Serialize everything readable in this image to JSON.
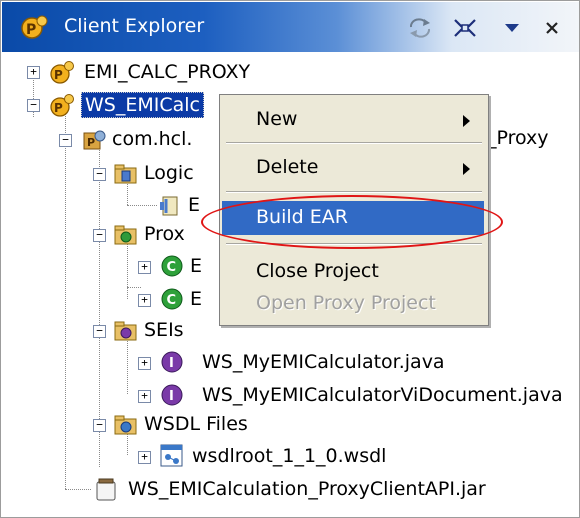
{
  "titlebar": {
    "title": "Client Explorer",
    "buttons": [
      "sync-icon",
      "collapse-all-icon",
      "view-menu-icon",
      "close-icon"
    ]
  },
  "tree": {
    "items": [
      {
        "label": "EMI_CALC_PROXY",
        "icon": "proxy-project-icon"
      },
      {
        "label": "WS_EMICalc",
        "icon": "proxy-project-icon"
      },
      {
        "label": "com.hcl.",
        "icon": "package-icon"
      },
      {
        "label": "Logic",
        "icon": "logical-folder-icon"
      },
      {
        "label": "E",
        "icon": "logical-item-icon"
      },
      {
        "label": "Prox",
        "icon": "proxy-folder-icon"
      },
      {
        "label": "E",
        "icon": "class-icon"
      },
      {
        "label": "E",
        "icon": "class-icon"
      },
      {
        "label": "SEIs",
        "icon": "sei-folder-icon"
      },
      {
        "label": "WS_MyEMICalculator.java",
        "icon": "interface-icon"
      },
      {
        "label": "WS_MyEMICalculatorViDocument.java",
        "icon": "interface-icon"
      },
      {
        "label": "WSDL Files",
        "icon": "wsdl-folder-icon"
      },
      {
        "label": "wsdlroot_1_1_0.wsdl",
        "icon": "wsdl-file-icon"
      },
      {
        "label": "WS_EMICalculation_ProxyClientAPI.jar",
        "icon": "jar-icon"
      }
    ],
    "partial_text": "_Proxy"
  },
  "context_menu": {
    "items": [
      {
        "label": "New",
        "submenu": true,
        "enabled": true
      },
      {
        "label": "Delete",
        "submenu": true,
        "enabled": true
      },
      {
        "label": "Build EAR",
        "submenu": false,
        "enabled": true,
        "highlighted": true
      },
      {
        "label": "Close Project",
        "submenu": false,
        "enabled": true
      },
      {
        "label": "Open Proxy Project",
        "submenu": false,
        "enabled": false
      }
    ]
  },
  "colors": {
    "selection": "#0b3aa6",
    "menu_highlight": "#316ac5",
    "annotation": "#e01515"
  }
}
